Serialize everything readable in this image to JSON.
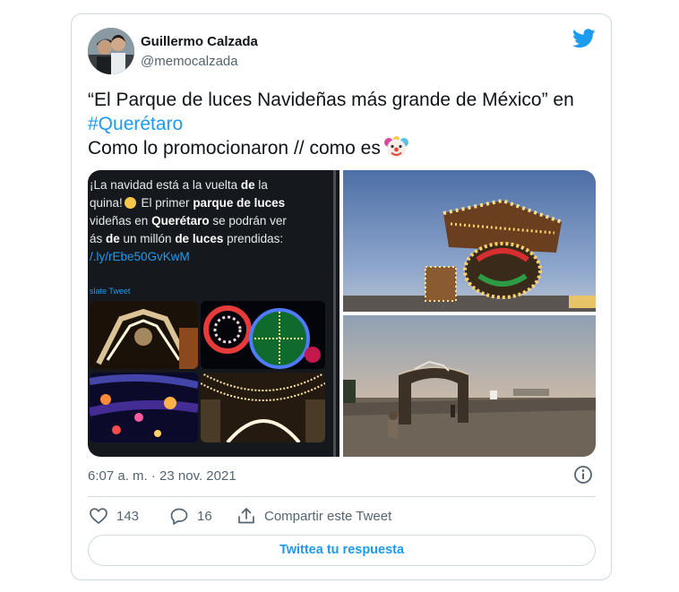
{
  "tweet": {
    "author": {
      "name": "Guillermo Calzada",
      "handle": "@memocalzada"
    },
    "text": {
      "line1": "“El Parque de luces Navideñas más grande de México” en",
      "hashtag": "#Querétaro",
      "line3": "Como lo promocionaron // como es"
    },
    "emoji": "clown-face",
    "screenshot": {
      "lines": [
        {
          "pre": "¡La navidad está a la vuelta ",
          "bold": "de",
          "post": " la"
        },
        {
          "pre": "quina!",
          "bold": "",
          "post": " El primer ",
          "bold2": "parque de luces"
        },
        {
          "pre": "videñas en ",
          "bold": "Querétaro",
          "post": " se podrán ver"
        },
        {
          "pre": "ás ",
          "bold": "de",
          "post": " un millón ",
          "bold2": "de luces",
          "post2": " prendidas:"
        }
      ],
      "link": "/.ly/rEbe50GvKwM",
      "translate": "slate Tweet"
    },
    "timestamp": "6:07 a. m. · 23 nov. 2021",
    "actions": {
      "likes": "143",
      "replies": "16",
      "share_label": "Compartir este Tweet"
    },
    "reply_button": "Twittea tu respuesta"
  },
  "colors": {
    "accent": "#1d9bf0",
    "text": "#0f1419",
    "secondary": "#536471",
    "border": "#cfd9de"
  },
  "icons": [
    "twitter-bird-icon",
    "info-icon",
    "heart-icon",
    "reply-icon",
    "share-icon",
    "clown-face-emoji"
  ]
}
